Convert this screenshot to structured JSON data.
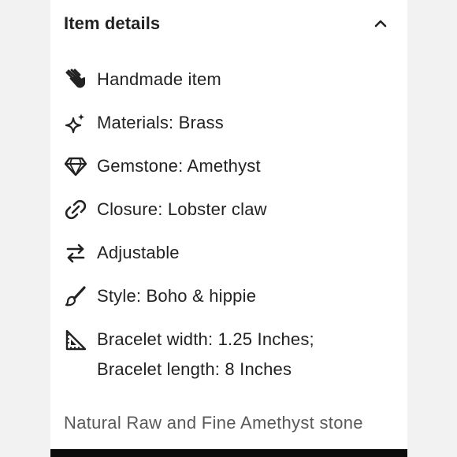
{
  "section": {
    "title": "Item details"
  },
  "details": [
    {
      "icon": "hand-icon",
      "label": "Handmade item"
    },
    {
      "icon": "sparkle-icon",
      "label": "Materials: Brass"
    },
    {
      "icon": "gem-icon",
      "label": "Gemstone: Amethyst"
    },
    {
      "icon": "link-icon",
      "label": "Closure: Lobster claw"
    },
    {
      "icon": "swap-arrows-icon",
      "label": "Adjustable"
    },
    {
      "icon": "brush-icon",
      "label": "Style: Boho & hippie"
    },
    {
      "icon": "ruler-triangle-icon",
      "label_line1": "Bracelet width: 1.25 Inches;",
      "label_line2": "Bracelet length: 8 Inches"
    }
  ],
  "description": {
    "text": "Natural Raw and Fine Amethyst stone"
  },
  "colors": {
    "text": "#222222",
    "muted_text": "#595959",
    "panel_bg": "#ffffff",
    "page_bg": "#f2f2f2"
  }
}
